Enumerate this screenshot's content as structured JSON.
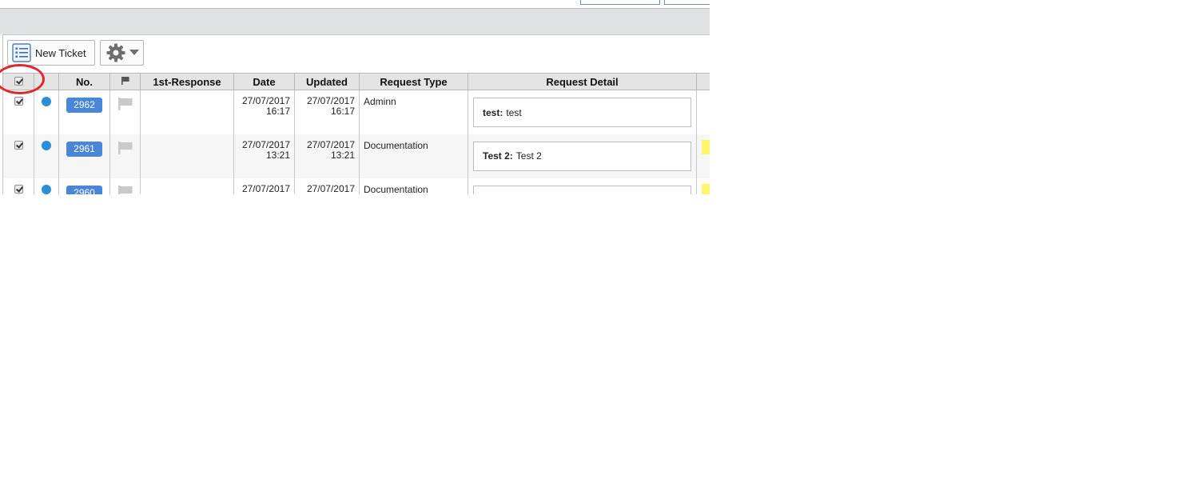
{
  "toolbar": {
    "new_ticket_label": "New Ticket",
    "new_ticket_icon": "list-icon",
    "settings_icon": "gear-icon"
  },
  "table": {
    "columns": [
      "",
      "",
      "No.",
      "",
      "1st-Response",
      "Date",
      "Updated",
      "Request Type",
      "Request Detail",
      ""
    ],
    "rows": [
      {
        "checked": true,
        "status_color": "#2b8fd6",
        "no": "2962",
        "first_response": "",
        "date_line1": "27/07/2017",
        "date_line2": "16:17",
        "updated_line1": "27/07/2017",
        "updated_line2": "16:17",
        "request_type": "Adminn",
        "detail_label": "test:",
        "detail_text": "test"
      },
      {
        "checked": true,
        "status_color": "#2b8fd6",
        "no": "2961",
        "first_response": "",
        "date_line1": "27/07/2017",
        "date_line2": "13:21",
        "updated_line1": "27/07/2017",
        "updated_line2": "13:21",
        "request_type": "Documentation",
        "detail_label": "Test 2:",
        "detail_text": "Test 2"
      },
      {
        "checked": true,
        "status_color": "#2b8fd6",
        "no": "2960",
        "first_response": "",
        "date_line1": "27/07/2017",
        "date_line2": "",
        "updated_line1": "27/07/2017",
        "updated_line2": "",
        "request_type": "Documentation",
        "detail_label": "",
        "detail_text": ""
      }
    ]
  },
  "colors": {
    "accent_blue": "#4a86d8",
    "status_dot": "#2b8fd6",
    "highlight_ring": "#e3262a",
    "tag_yellow": "#fff66a"
  }
}
